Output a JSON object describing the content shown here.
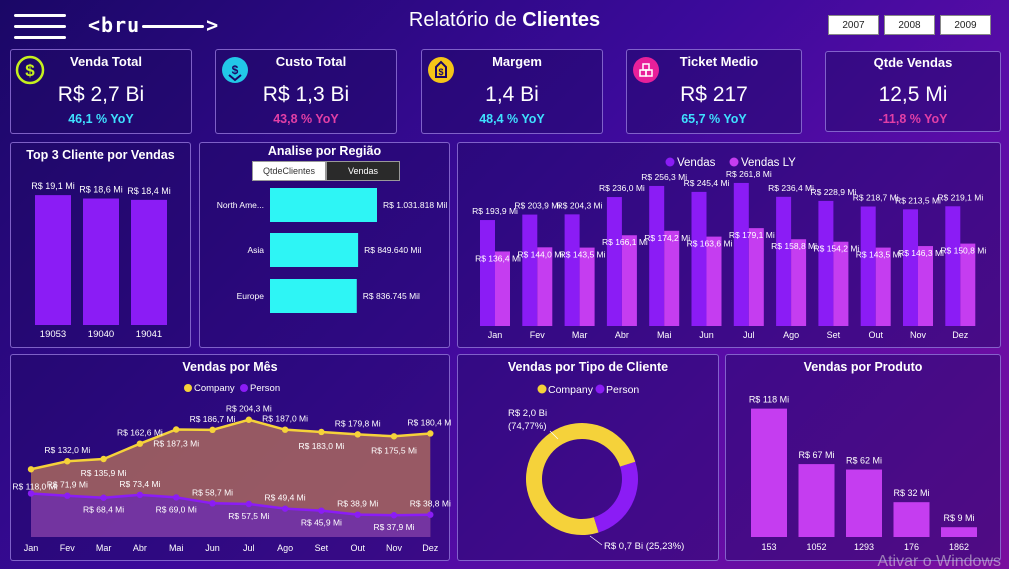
{
  "header": {
    "title_prefix": "Relatório de ",
    "title_bold": "Clientes",
    "logo_left": "<bru",
    "logo_right": ">",
    "years": [
      "2007",
      "2008",
      "2009"
    ]
  },
  "kpis": [
    {
      "title": "Venda Total",
      "value": "R$ 2,7 Bi",
      "yoy": "46,1 % YoY",
      "yoy_color": "#3fe0ff",
      "icon": "dollar-icon",
      "icon_color": "#c6f01e"
    },
    {
      "title": "Custo Total",
      "value": "R$ 1,3 Bi",
      "yoy": "43,8 % YoY",
      "yoy_color": "#e23fa6",
      "icon": "money-down-icon",
      "icon_color": "#22c8e8"
    },
    {
      "title": "Margem",
      "value": "1,4 Bi",
      "yoy": "48,4 % YoY",
      "yoy_color": "#3fe0ff",
      "icon": "money-bag-icon",
      "icon_color": "#f5c518"
    },
    {
      "title": "Ticket Medio",
      "value": "R$ 217",
      "yoy": "65,7 % YoY",
      "yoy_color": "#3fe0ff",
      "icon": "boxes-icon",
      "icon_color": "#e8209a"
    },
    {
      "title": "Qtde Vendas",
      "value": "12,5 Mi",
      "yoy": "-11,8 % YoY",
      "yoy_color": "#e23fa6"
    }
  ],
  "top3": {
    "title": "Top 3 Cliente por Vendas",
    "chart_data": {
      "type": "bar",
      "categories": [
        "19053",
        "19040",
        "19041"
      ],
      "values": [
        19.1,
        18.6,
        18.4
      ],
      "labels": [
        "R$ 19,1 Mi",
        "R$ 18,6 Mi",
        "R$ 18,4 Mi"
      ],
      "ylim": [
        0,
        20
      ],
      "color": "#8b1cf5"
    }
  },
  "regiao": {
    "title": "Analise por Região",
    "tabs": [
      "QtdeClientes",
      "Vendas"
    ],
    "chart_data": {
      "type": "bar",
      "orientation": "horizontal",
      "categories": [
        "North Ame...",
        "Asia",
        "Europe"
      ],
      "values": [
        1031818,
        849640,
        836745
      ],
      "labels": [
        "R$ 1.031.818 Mil",
        "R$ 849.640 Mil",
        "R$ 836.745 Mil"
      ],
      "color": "#2ef5f5"
    }
  },
  "vendas_ly": {
    "legend": [
      "Vendas",
      "Vendas LY"
    ],
    "colors": [
      "#8b1cf5",
      "#c53df0"
    ],
    "chart_data": {
      "type": "bar",
      "categories": [
        "Jan",
        "Fev",
        "Mar",
        "Abr",
        "Mai",
        "Jun",
        "Jul",
        "Ago",
        "Set",
        "Out",
        "Nov",
        "Dez"
      ],
      "series": [
        {
          "name": "Vendas",
          "values": [
            193.9,
            203.9,
            204.3,
            236.0,
            256.3,
            245.4,
            261.8,
            236.4,
            228.9,
            218.7,
            213.5,
            219.1
          ],
          "labels": [
            "R$ 193,9 Mi",
            "R$ 203,9 Mi",
            "R$ 204,3 Mi",
            "R$ 236,0 Mi",
            "R$ 256,3 Mi",
            "R$ 245,4 Mi",
            "R$ 261,8 Mi",
            "R$ 236,4 Mi",
            "R$ 228,9 Mi",
            "R$ 218,7 Mi",
            "R$ 213,5 Mi",
            "R$ 219,1 Mi"
          ]
        },
        {
          "name": "Vendas LY",
          "values": [
            136.4,
            144.0,
            143.5,
            166.1,
            174.2,
            163.6,
            179.1,
            158.8,
            154.2,
            143.5,
            146.3,
            150.8
          ],
          "labels": [
            "R$ 136,4 Mi",
            "R$ 144,0 Mi",
            "R$ 143,5 Mi",
            "R$ 166,1 Mi",
            "R$ 174,2 Mi",
            "R$ 163,6 Mi",
            "R$ 179,1 Mi",
            "R$ 158,8 Mi",
            "R$ 154,2 Mi",
            "R$ 143,5 Mi",
            "R$ 146,3 Mi",
            "R$ 150,8 Mi"
          ]
        }
      ],
      "ylim": [
        0,
        280
      ]
    }
  },
  "vendas_mes": {
    "title": "Vendas por Mês",
    "legend": [
      "Company",
      "Person"
    ],
    "colors": [
      "#f5d23a",
      "#8b1cf5"
    ],
    "chart_data": {
      "type": "area",
      "categories": [
        "Jan",
        "Fev",
        "Mar",
        "Abr",
        "Mai",
        "Jun",
        "Jul",
        "Ago",
        "Set",
        "Out",
        "Nov",
        "Dez"
      ],
      "series": [
        {
          "name": "Company",
          "values": [
            118.0,
            132.0,
            135.9,
            162.6,
            187.3,
            186.7,
            204.3,
            187.0,
            183.0,
            178.8,
            175.5,
            180.4
          ],
          "labels": [
            "R$ 118,0 Mi",
            "R$ 132,0 Mi",
            "R$ 135,9 Mi",
            "R$ 162,6 Mi",
            "R$ 187,3 Mi",
            "R$ 186,7 Mi",
            "R$ 204,3 Mi",
            "R$ 187,0 Mi",
            "R$ 183,0 Mi",
            "R$ 179,8 Mi",
            "R$ 175,5 Mi",
            "R$ 180,4 Mi"
          ]
        },
        {
          "name": "Person",
          "values": [
            75.9,
            71.9,
            68.4,
            73.4,
            69.0,
            58.7,
            57.5,
            49.4,
            45.9,
            38.9,
            37.9,
            38.8
          ],
          "labels": [
            "",
            "R$ 71,9 Mi",
            "R$ 68,4 Mi",
            "R$ 73,4 Mi",
            "R$ 69,0 Mi",
            "R$ 58,7 Mi",
            "R$ 57,5 Mi",
            "R$ 49,4 Mi",
            "R$ 45,9 Mi",
            "R$ 38,9 Mi",
            "R$ 37,9 Mi",
            "R$ 38,8 Mi"
          ]
        }
      ],
      "ylim": [
        0,
        230
      ]
    }
  },
  "tipo": {
    "title": "Vendas por Tipo de Cliente",
    "legend": [
      "Company",
      "Person"
    ],
    "colors": [
      "#f5d23a",
      "#8b1cf5"
    ],
    "chart_data": {
      "type": "pie",
      "categories": [
        "Company",
        "Person"
      ],
      "values": [
        74.77,
        25.23
      ],
      "labels": [
        "R$ 2,0 Bi",
        "R$ 0,7 Bi (25,23%)"
      ],
      "company_pct": "(74,77%)"
    }
  },
  "produto": {
    "title": "Vendas por Produto",
    "chart_data": {
      "type": "bar",
      "categories": [
        "153",
        "1052",
        "1293",
        "176",
        "1862"
      ],
      "values": [
        118,
        67,
        62,
        32,
        9
      ],
      "labels": [
        "R$ 118 Mi",
        "R$ 67 Mi",
        "R$ 62 Mi",
        "R$ 32 Mi",
        "R$ 9 Mi"
      ],
      "ylim": [
        0,
        125
      ],
      "color": "#c53df0"
    }
  },
  "watermark": "Ativar o Windows"
}
